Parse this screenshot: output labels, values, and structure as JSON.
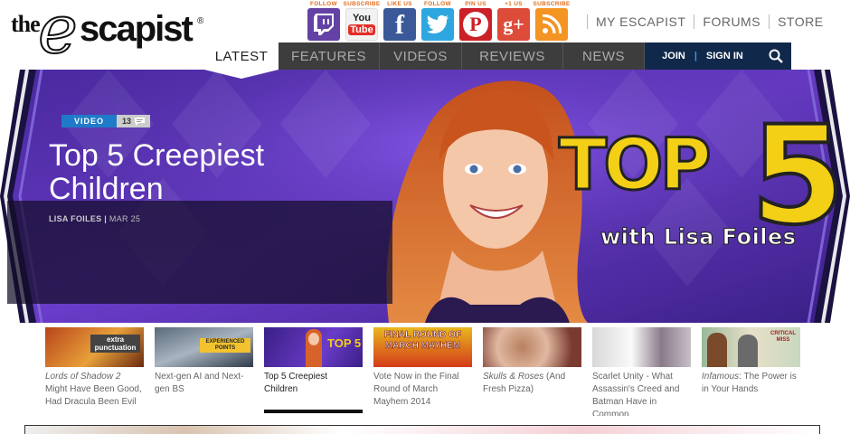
{
  "logo": {
    "the": "the",
    "e": "e",
    "scapist": "scapist",
    "reg": "®"
  },
  "social": [
    {
      "caption": "FOLLOW",
      "icon": "twitch-icon",
      "glyph": "t",
      "color": "#6441a5"
    },
    {
      "caption": "SUBSCRIBE",
      "icon": "youtube-icon",
      "glyph": "You\nTube",
      "color": "#e52d27"
    },
    {
      "caption": "LIKE US",
      "icon": "facebook-icon",
      "glyph": "f",
      "color": "#3b5998"
    },
    {
      "caption": "FOLLOW",
      "icon": "twitter-icon",
      "glyph": "🐦",
      "color": "#2ea6e0"
    },
    {
      "caption": "PIN US",
      "icon": "pinterest-icon",
      "glyph": "P",
      "color": "#cb2027"
    },
    {
      "caption": "+1 US",
      "icon": "google-plus-icon",
      "glyph": "g+",
      "color": "#dd4b39"
    },
    {
      "caption": "SUBSCRIBE",
      "icon": "rss-icon",
      "glyph": "⦿",
      "color": "#f39423"
    }
  ],
  "social_caption_color": "#e07020",
  "toplinks": [
    "MY ESCAPIST",
    "FORUMS",
    "STORE"
  ],
  "nav": {
    "active": "LATEST",
    "tabs": [
      "FEATURES",
      "VIDEOS",
      "REVIEWS",
      "NEWS"
    ],
    "join": "JOIN",
    "signin": "SIGN IN",
    "search_icon": "search-icon"
  },
  "hero": {
    "badge": "VIDEO",
    "comments": "13",
    "title": "Top 5 Creepiest Children",
    "author": "LISA FOILES",
    "date": "MAR 25",
    "logo_top": "TOP",
    "logo_five": "5",
    "logo_with": "with Lisa Foiles"
  },
  "thumbnails": [
    {
      "italic": "Lords of Shadow 2",
      "text": " Might Have Been Good, Had Dracula Been Evil",
      "imgtext": "extra punctuation",
      "active": false
    },
    {
      "italic": "",
      "text": "Next-gen AI and Next-gen BS",
      "imgtext": "EXPERIENCED POINTS",
      "active": false
    },
    {
      "italic": "",
      "text": "Top 5 Creepiest Children",
      "imgtext": "TOP 5",
      "active": true
    },
    {
      "italic": "",
      "text": "Vote Now in the Final Round of March Mayhem 2014",
      "imgtext": "FINAL ROUND OF MARCH MAYHEM",
      "active": false
    },
    {
      "italic": "Skulls & Roses",
      "text": " (And Fresh Pizza)",
      "imgtext": "",
      "active": false
    },
    {
      "italic": "",
      "text": "Scarlet Unity - What Assassin's Creed and Batman Have in Common",
      "imgtext": "",
      "active": false
    },
    {
      "italic": "Infamous",
      "text": ": The Power is in Your Hands",
      "imgtext": "CRITICAL MISS",
      "active": false
    }
  ]
}
